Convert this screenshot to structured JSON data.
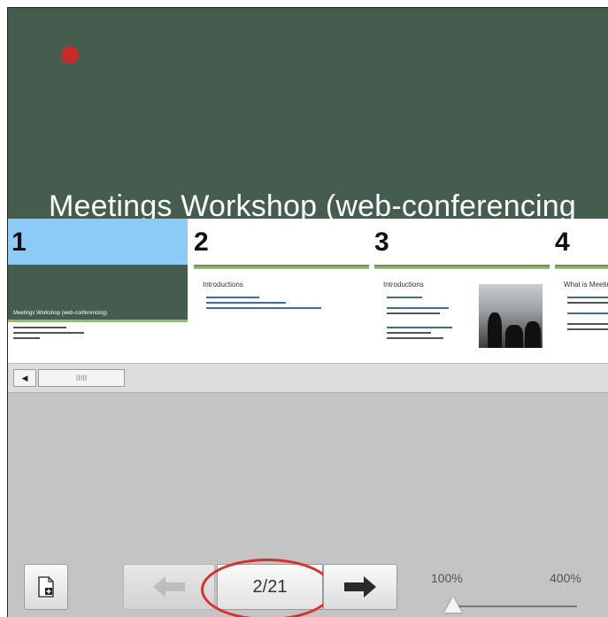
{
  "presentation": {
    "current_slide_title": "Meetings Workshop (web-conferencing"
  },
  "thumbnails": [
    {
      "number": "1",
      "selected": true,
      "mini_title": "Meetings Workshop (web-conferencing)",
      "body_lines": [
        "",
        "",
        ""
      ]
    },
    {
      "number": "2",
      "selected": false,
      "header": "Introductions",
      "body_lines": [
        "",
        "",
        ""
      ]
    },
    {
      "number": "3",
      "selected": false,
      "header": "Introductions",
      "body_lines": [
        "",
        "",
        "",
        "",
        "",
        ""
      ]
    },
    {
      "number": "4",
      "selected": false,
      "header": "What is Meetings",
      "body_lines": [
        "",
        "",
        "",
        "",
        ""
      ]
    }
  ],
  "scrollbar": {
    "left_arrow": "◀",
    "thumb_grip": "IIIII"
  },
  "navigation": {
    "page_counter": "2/21",
    "prev_arrow": "⬅",
    "next_arrow": "➡"
  },
  "zoom": {
    "min_label": "100%",
    "max_label": "400%",
    "value_percent": 100
  },
  "colors": {
    "slide_background": "#455d4f",
    "selected_thumb": "#8bcbf8",
    "highlight_ring": "#d9302c",
    "title_dot": "#c62a2a"
  }
}
